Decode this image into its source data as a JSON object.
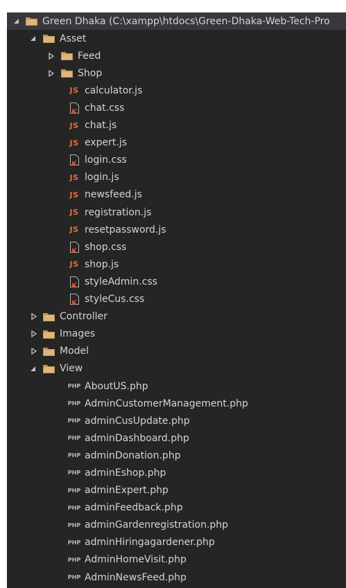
{
  "explorer": {
    "root": {
      "label": "Green Dhaka (C:\\xampp\\htdocs\\Green-Dhaka-Web-Tech-Pro"
    },
    "asset": {
      "label": "Asset",
      "folders": [
        "Feed",
        "Shop"
      ],
      "files": [
        {
          "name": "calculator.js",
          "type": "js"
        },
        {
          "name": "chat.css",
          "type": "css"
        },
        {
          "name": "chat.js",
          "type": "js"
        },
        {
          "name": "expert.js",
          "type": "js"
        },
        {
          "name": "login.css",
          "type": "css"
        },
        {
          "name": "login.js",
          "type": "js"
        },
        {
          "name": "newsfeed.js",
          "type": "js"
        },
        {
          "name": "registration.js",
          "type": "js"
        },
        {
          "name": "resetpassword.js",
          "type": "js"
        },
        {
          "name": "shop.css",
          "type": "css"
        },
        {
          "name": "shop.js",
          "type": "js"
        },
        {
          "name": "styleAdmin.css",
          "type": "css"
        },
        {
          "name": "styleCus.css",
          "type": "css"
        }
      ]
    },
    "collapsed_folders": [
      "Controller",
      "Images",
      "Model"
    ],
    "view": {
      "label": "View",
      "files": [
        "AboutUS.php",
        "AdminCustomerManagement.php",
        "adminCusUpdate.php",
        "adminDashboard.php",
        "adminDonation.php",
        "adminEshop.php",
        "adminExpert.php",
        "adminFeedback.php",
        "adminGardenregistration.php",
        "adminHiringagardener.php",
        "AdminHomeVisit.php",
        "AdminNewsFeed.php"
      ]
    },
    "icon_text": {
      "js": "JS",
      "php": "PHP"
    },
    "colors": {
      "background": "#252526",
      "text": "#d4d4d4",
      "folder": "#c09553",
      "js": "#e06c3c",
      "css": "#e34c26"
    }
  }
}
